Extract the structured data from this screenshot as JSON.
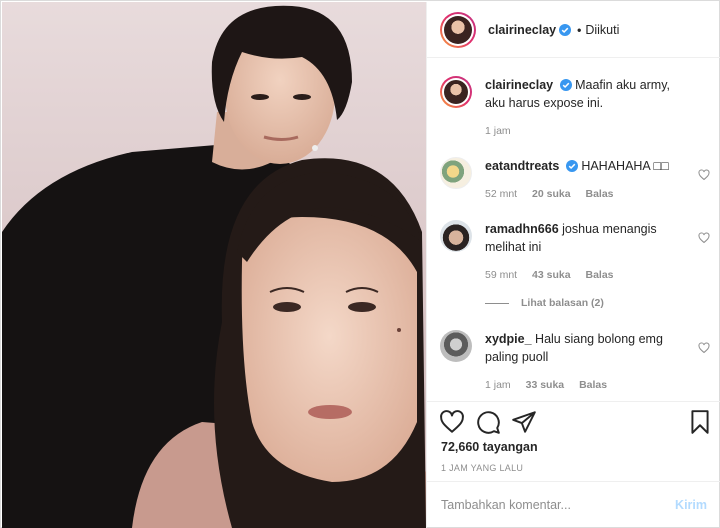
{
  "colors": {
    "accent": "#0095f6",
    "verified": "#3897f0",
    "muted": "#8e8e8e"
  },
  "header": {
    "username": "clairineclay",
    "follow_status": "Diikuti"
  },
  "caption": {
    "username": "clairineclay",
    "text": "Maafin aku army, aku harus expose ini.",
    "time": "1 jam"
  },
  "comments": [
    {
      "username": "eatandtreats",
      "verified": true,
      "text": "HAHAHAHA □□",
      "time": "52 mnt",
      "likes": "20 suka",
      "reply": "Balas"
    },
    {
      "username": "ramadhn666",
      "verified": false,
      "text": "joshua menangis melihat ini",
      "time": "59 mnt",
      "likes": "43 suka",
      "reply": "Balas"
    },
    {
      "username": "xydpie_",
      "verified": false,
      "text": "Halu siang bolong emg paling puoll",
      "time": "1 jam",
      "likes": "33 suka",
      "reply": "Balas"
    }
  ],
  "view_replies": "Lihat balasan (2)",
  "actions": {
    "views": "72,660 tayangan",
    "posted": "1 JAM YANG LALU"
  },
  "composer": {
    "placeholder": "Tambahkan komentar...",
    "send_label": "Kirim"
  },
  "icons": [
    "heart-icon",
    "comment-icon",
    "share-icon",
    "bookmark-icon",
    "verified-badge-icon"
  ]
}
